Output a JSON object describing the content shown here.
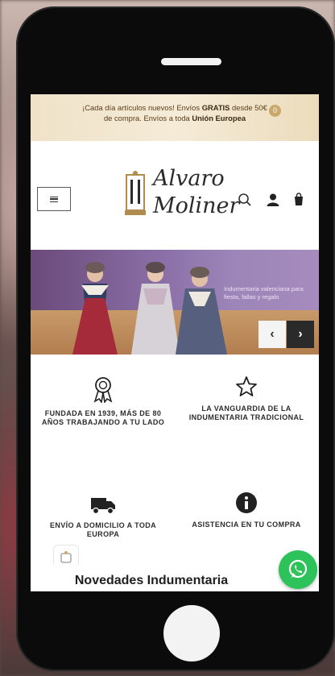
{
  "promo": {
    "line1_prefix": "¡Cada día artículos nuevos! Envíos ",
    "line1_bold": "GRATIS",
    "line1_suffix": " desde 50€",
    "line2_prefix": "de compra. Envíos a toda ",
    "line2_bold": "Unión Europea"
  },
  "header": {
    "logo_line1": "Alvaro",
    "logo_line2": "Moliner",
    "cart_count": "0"
  },
  "hero": {
    "caption": "Indumentaria valenciana para fiesta, fallas y regalo"
  },
  "features": [
    {
      "icon": "award-ribbon-icon",
      "text": "FUNDADA EN 1939, MÁS DE 80 AÑOS TRABAJANDO A TU LADO"
    },
    {
      "icon": "star-icon",
      "text": "LA VANGUARDIA DE LA INDUMENTARIA TRADICIONAL"
    },
    {
      "icon": "truck-icon",
      "text": "ENVÍO A DOMICILIO A TODA EUROPA"
    },
    {
      "icon": "info-icon",
      "text": "ASISTENCIA EN TU COMPRA"
    }
  ],
  "section": {
    "title": "Novedades Indumentaria"
  },
  "colors": {
    "accent": "#caa86a",
    "whatsapp": "#2ec25a",
    "promo_bg": "#f2e6cf"
  }
}
